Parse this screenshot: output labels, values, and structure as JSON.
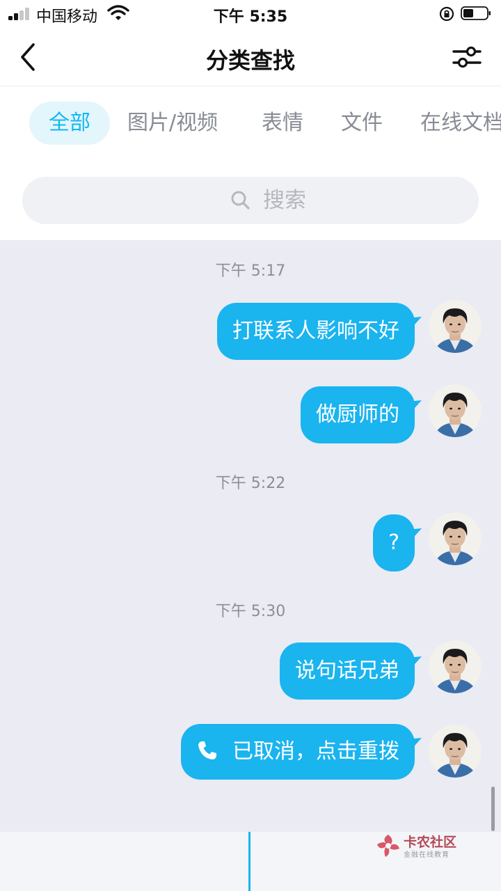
{
  "status_bar": {
    "carrier": "中国移动",
    "time": "下午 5:35",
    "signal_bars": 2
  },
  "nav": {
    "title": "分类查找",
    "back_icon": "chevron-left-icon",
    "filter_icon": "sliders-icon"
  },
  "tabs": [
    {
      "label": "全部",
      "active": true
    },
    {
      "label": "图片/视频",
      "active": false
    },
    {
      "label": "表情",
      "active": false
    },
    {
      "label": "文件",
      "active": false
    },
    {
      "label": "在线文档",
      "active": false
    }
  ],
  "search": {
    "placeholder": "搜索",
    "icon": "search-icon"
  },
  "messages": [
    {
      "type": "timestamp",
      "text": "下午 5:17"
    },
    {
      "type": "bubble",
      "text": "打联系人影响不好"
    },
    {
      "type": "bubble",
      "text": "做厨师的"
    },
    {
      "type": "timestamp",
      "text": "下午 5:22"
    },
    {
      "type": "bubble",
      "text": "?"
    },
    {
      "type": "timestamp",
      "text": "下午 5:30"
    },
    {
      "type": "bubble",
      "text": "说句话兄弟"
    },
    {
      "type": "call",
      "text": "已取消，点击重拨",
      "icon": "phone-icon"
    }
  ],
  "watermark": {
    "name": "卡农社区",
    "sub": "金融在线教育"
  },
  "colors": {
    "accent": "#12b7f5",
    "bubble": "#1ab4ef",
    "chat_bg": "#eaebf3",
    "tab_active_bg": "#e3f6fc"
  }
}
